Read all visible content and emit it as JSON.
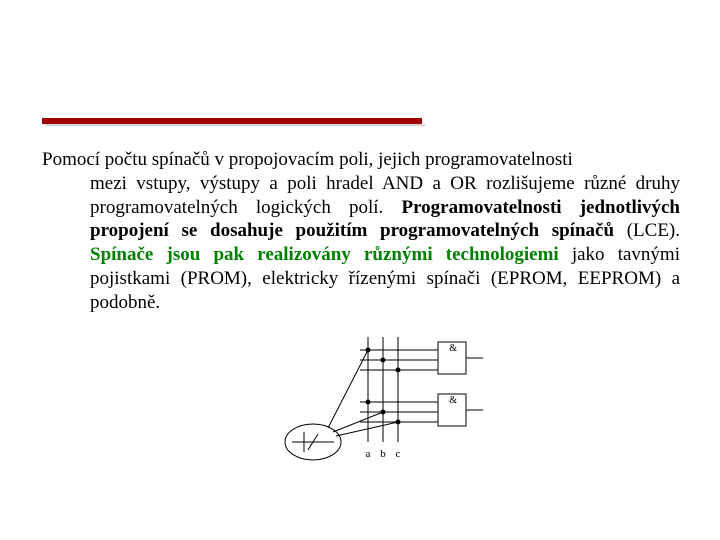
{
  "para": {
    "l1": "Pomocí počtu spínačů v propojovacím poli, jejich programovatelnosti",
    "l2a": "mezi vstupy, výstupy a poli hradel AND a OR rozlišujeme různé druhy programovatelných logických polí. ",
    "l2b": "Programovatelnosti jednotlivých propojení se dosahuje použitím programovatelných spínačů",
    "l2c": " (LCE). ",
    "l2d": "Spínače jsou pak realizovány různými technologiemi",
    "l2e": " jako tavnými pojistkami (PROM), elektricky řízenými spínači (EPROM, EEPROM) a podobně."
  },
  "diagram": {
    "labels": {
      "a": "a",
      "b": "b",
      "c": "c",
      "and": "&"
    }
  }
}
